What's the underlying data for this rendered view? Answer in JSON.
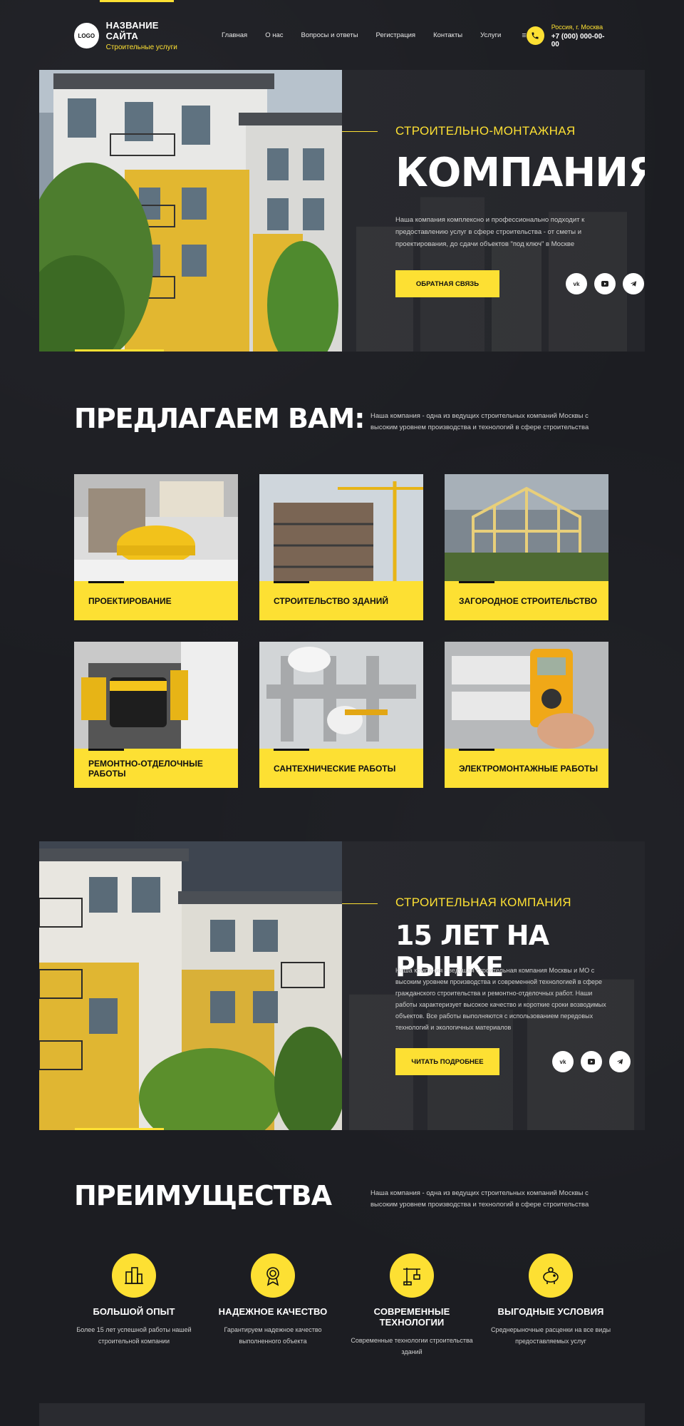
{
  "header": {
    "logo_text": "LOGO",
    "site_name": "НАЗВАНИЕ САЙТА",
    "site_subtitle": "Строительные услуги",
    "nav": [
      "Главная",
      "О нас",
      "Вопросы и ответы",
      "Регистрация",
      "Контакты",
      "Услуги"
    ],
    "nav_more": "≡",
    "region": "Россия, г. Москва",
    "phone": "+7 (000) 000-00-00"
  },
  "hero": {
    "pretitle": "СТРОИТЕЛЬНО-МОНТАЖНАЯ",
    "title": "КОМПАНИЯ",
    "text": "Наша компания комплексно и профессионально подходит к предоставлению услуг в сфере строительства - от сметы и проектирования, до сдачи объектов \"под ключ\" в Москве",
    "button": "ОБРАТНАЯ СВЯЗЬ",
    "socials": [
      "vk-icon",
      "youtube-icon",
      "telegram-icon"
    ]
  },
  "offer": {
    "title": "ПРЕДЛАГАЕМ ВАМ:",
    "text": "Наша компания - одна из ведущих строительных компаний Москвы с высоким уровнем производства и технологий в сфере строительства",
    "cards": [
      "ПРОЕКТИРОВАНИЕ",
      "СТРОИТЕЛЬСТВО ЗДАНИЙ",
      "ЗАГОРОДНОЕ СТРОИТЕЛЬСТВО",
      "РЕМОНТНО-ОТДЕЛОЧНЫЕ РАБОТЫ",
      "САНТЕХНИЧЕСКИЕ РАБОТЫ",
      "ЭЛЕКТРОМОНТАЖНЫЕ РАБОТЫ"
    ]
  },
  "about": {
    "pretitle": "СТРОИТЕЛЬНАЯ КОМПАНИЯ",
    "title": "15 ЛЕТ НА РЫНКЕ",
    "text": "Наша компания - ведущая строительная компания Москвы и МО с высоким уровнем производства и современной технологией в сфере гражданского строительства и ремонтно-отделочных работ. Наши работы характеризует высокое качество и короткие сроки возводимых объектов. Все работы выполняются с использованием передовых технологий и экологичных материалов",
    "button": "ЧИТАТЬ ПОДРОБНЕЕ"
  },
  "advantages": {
    "title": "ПРЕИМУЩЕСТВА",
    "text": "Наша компания - одна из ведущих строительных компаний Москвы с высоким уровнем производства и технологий в сфере строительства",
    "items": [
      {
        "title": "БОЛЬШОЙ ОПЫТ",
        "text": "Более 15 лет успешной работы нашей строительной компании",
        "icon": "buildings-icon"
      },
      {
        "title": "НАДЕЖНОЕ КАЧЕСТВО",
        "text": "Гарантируем надежное качество выполненного объекта",
        "icon": "award-icon"
      },
      {
        "title": "СОВРЕМЕННЫЕ ТЕХНОЛОГИИ",
        "text": "Современные технологии строительства зданий",
        "icon": "crane-icon"
      },
      {
        "title": "ВЫГОДНЫЕ УСЛОВИЯ",
        "text": "Среднерыночные расценки на все виды предоставляемых услуг",
        "icon": "piggy-bank-icon"
      }
    ]
  },
  "colors": {
    "accent": "#fde033",
    "background": "#1c1d22",
    "panel": "#2a2b30"
  }
}
